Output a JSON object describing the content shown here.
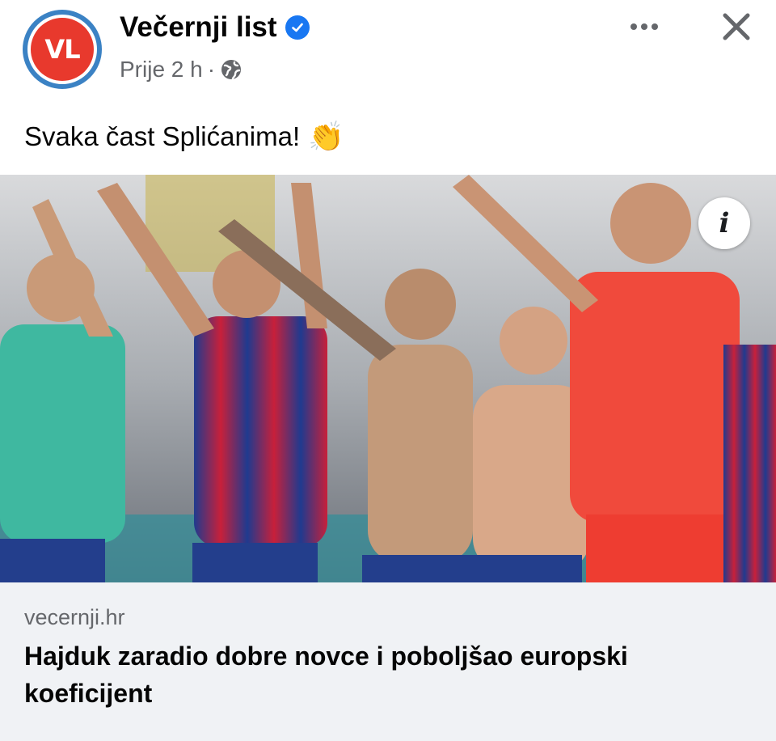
{
  "post": {
    "page_name": "Večernji list",
    "avatar_text": "VL",
    "timestamp": "Prije 2 h",
    "separator": "·",
    "audience_icon": "globe-icon",
    "verified_icon": "verified-badge-icon",
    "text": "Svaka čast Splićanima!",
    "emoji": "👏"
  },
  "photo": {
    "info_label": "i",
    "description_icon": "football-team-celebrating-photo"
  },
  "link_preview": {
    "domain": "vecernji.hr",
    "headline": "Hajduk zaradio dobre novce i poboljšao europski koeficijent"
  },
  "colors": {
    "avatar_ring": "#3b82c4",
    "avatar_fill": "#e8392d",
    "verified": "#1877f2",
    "secondary_text": "#65676b",
    "preview_bg": "#f0f2f5"
  }
}
